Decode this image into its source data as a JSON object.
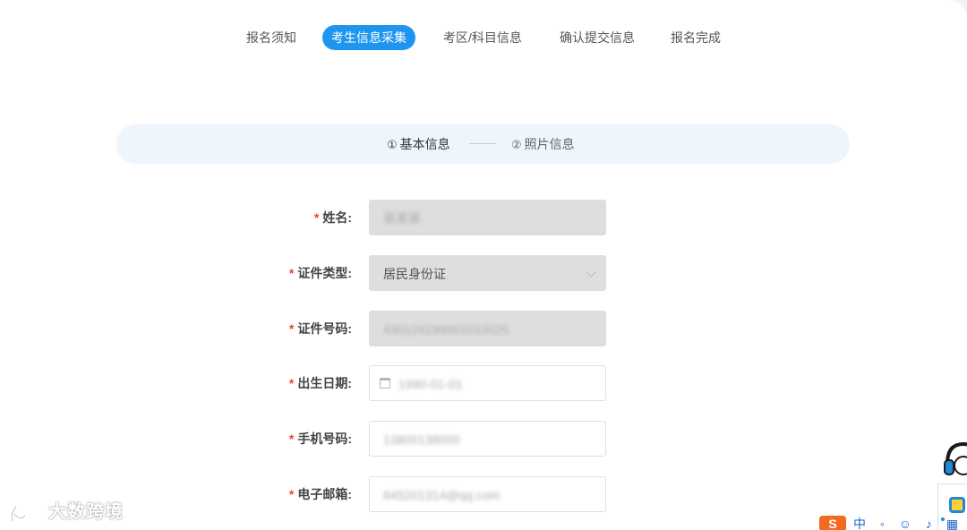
{
  "steps": [
    {
      "label": "报名须知",
      "active": false
    },
    {
      "label": "考生信息采集",
      "active": true
    },
    {
      "label": "考区/科目信息",
      "active": false
    },
    {
      "label": "确认提交信息",
      "active": false
    },
    {
      "label": "报名完成",
      "active": false
    }
  ],
  "substeps": {
    "one": {
      "num": "①",
      "label": "基本信息"
    },
    "two": {
      "num": "②",
      "label": "照片信息"
    }
  },
  "form": {
    "required_mark": "*",
    "name": {
      "label": "姓名:",
      "value": "吴某某"
    },
    "id_type": {
      "label": "证件类型:",
      "value": "居民身份证"
    },
    "id_number": {
      "label": "证件号码:",
      "value": "430124199001010025"
    },
    "birth_date": {
      "label": "出生日期:",
      "value": "1990-01-01"
    },
    "phone": {
      "label": "手机号码:",
      "value": "13800138000"
    },
    "email": {
      "label": "电子邮箱:",
      "value": "845201314@qq.com"
    }
  },
  "watermark": {
    "text": "大数跨境"
  },
  "tray": {
    "ime": "S",
    "items": "中 ◦ ☺ ♪ ▦"
  },
  "colors": {
    "accent": "#1e96f0",
    "required": "#e5473b",
    "disabled_bg": "#dedede",
    "banner_bg": "#eef5fd"
  }
}
